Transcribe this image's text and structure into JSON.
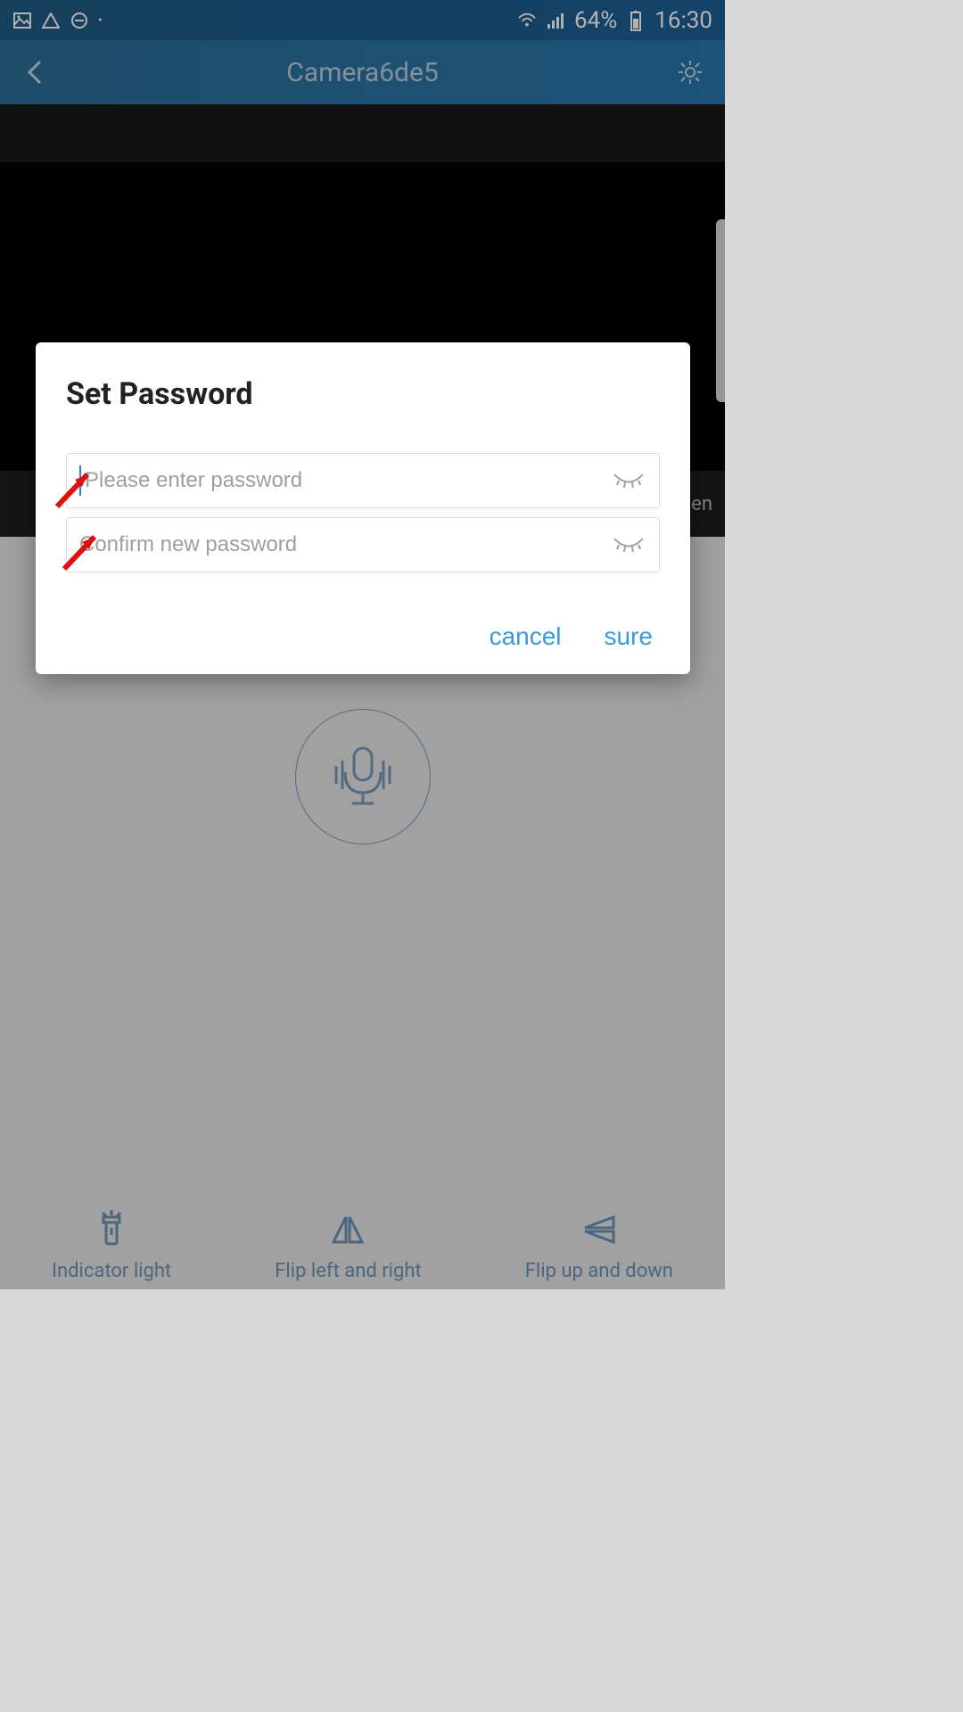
{
  "statusbar": {
    "battery_pct": "64%",
    "time": "16:30"
  },
  "header": {
    "title": "Camera6de5"
  },
  "background_text": {
    "partial_right": "en"
  },
  "dialog": {
    "title": "Set Password",
    "password_placeholder": "Please enter password",
    "confirm_placeholder": "Confirm new password",
    "cancel_label": "cancel",
    "sure_label": "sure"
  },
  "bottom": {
    "indicator_label": "Indicator light",
    "flip_lr_label": "Flip left and right",
    "flip_ud_label": "Flip up and down"
  },
  "colors": {
    "accent": "#3a98e0",
    "annotation": "#d11"
  }
}
